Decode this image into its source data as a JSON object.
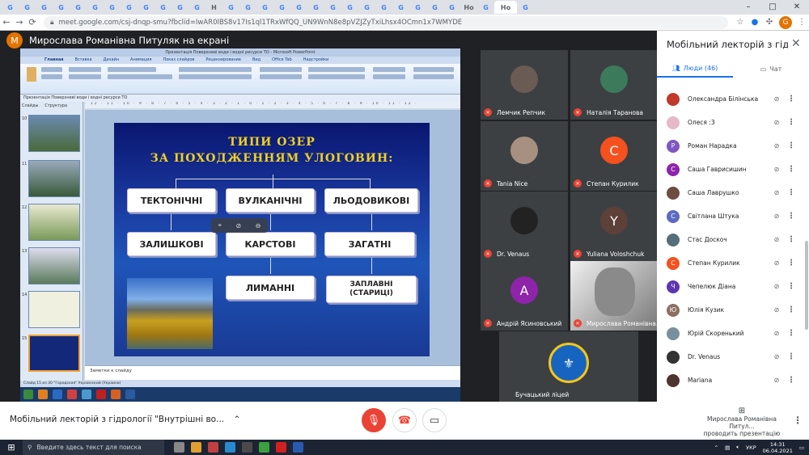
{
  "browser": {
    "tab_icons": [
      "G",
      "G",
      "G",
      "G",
      "G",
      "G",
      "G",
      "G",
      "G",
      "G",
      "G",
      "G",
      "H",
      "G",
      "G",
      "G",
      "G",
      "G",
      "G",
      "G",
      "G",
      "G",
      "G",
      "G",
      "G",
      "G",
      "G",
      "Ho",
      "G",
      "Ho",
      "G"
    ],
    "url": "meet.google.com/csj-dnqp-smu?fbclid=IwAR0IBS8v17Is1ql1TRxWfQQ_UN9WnN8e8pVZJZyTxiLhsx4OCmn1x7WMYDE",
    "profile_initial": "G",
    "window_controls": [
      "–",
      "□",
      "✕"
    ]
  },
  "presenter": {
    "initial": "M",
    "title": "Мирослава Романівна Питуляк на екрані"
  },
  "powerpoint": {
    "title_bar": "Презентація Поверхневі води і водні ресурси ТО - Microsoft PowerPoint",
    "ribbon_tabs": [
      "Главная",
      "Вставка",
      "Дизайн",
      "Анимация",
      "Показ слайдов",
      "Рецензирование",
      "Вид",
      "Office Tab",
      "Надстройки"
    ],
    "pane_tabs": [
      "Слайды",
      "Структура"
    ],
    "document_tab": "Презентація Поверхневі води і водні ресурси ТО",
    "slide_numbers": [
      "10",
      "11",
      "12",
      "13",
      "14",
      "15"
    ],
    "ruler": "· 12 · 11 · 10 · 9 · 8 · 7 · 6 · 5 · 4 · 3 · 2 · 1 · 0 · 1 · 2 · 3 · 4 · 5 · 6 · 7 · 8 · 9 · 10 · 11 · 12 ·",
    "notes_placeholder": "Заметки к слайду",
    "status": "Слайд 15 из 30    \"Городская\"    Украинский (Украина)"
  },
  "slide": {
    "title_line1": "ТИПИ   ОЗЕР",
    "title_line2": "ЗА  ПОХОДЖЕННЯМ  УЛОГОВИН:",
    "types": {
      "tectonic": "ТЕКТОНІЧНІ",
      "volcanic": "ВУЛКАНІЧНІ",
      "glacial": "ЛЬОДОВИКОВІ",
      "residual": "ЗАЛИШКОВІ",
      "karst": "КАРСТОВІ",
      "dammed": "ЗАГАТНІ",
      "estuary": "ЛИМАННІ",
      "floodplain": "ЗАПЛАВНІ\n(СТАРИЦІ)"
    }
  },
  "participants_grid": [
    {
      "name": "Лемчик Репчик",
      "avatar": "photo",
      "color": "#6b5b55"
    },
    {
      "name": "Наталія Таранова",
      "avatar": "photo",
      "color": "#3c7a5c"
    },
    {
      "name": "Tania Nice",
      "avatar": "photo",
      "color": "#a89080"
    },
    {
      "name": "Степан Курилик",
      "avatar": "С",
      "color": "#f4511e"
    },
    {
      "name": "Dr. Venaus",
      "avatar": "photo",
      "color": "#222222"
    },
    {
      "name": "Yuliana Voloshchuk",
      "avatar": "Y",
      "color": "#5d4037"
    },
    {
      "name": "Андрій Ясиновський",
      "avatar": "А",
      "color": "#8e24aa"
    },
    {
      "name": "Мирослава Романівна...",
      "avatar": "video",
      "color": "#cfcfcf"
    },
    {
      "name": "Бучацький ліцей",
      "avatar": "emblem",
      "color": "#1565c0"
    }
  ],
  "side_panel": {
    "title": "Мобільний лекторій з гідрології...",
    "tab_people": "Люди (46)",
    "tab_chat": "Чат",
    "people": [
      {
        "name": "Олександра Білінська",
        "initial": "",
        "color": "#c0392b"
      },
      {
        "name": "Олеся :3",
        "initial": "",
        "color": "#e6b8c8"
      },
      {
        "name": "Роман Нарадка",
        "initial": "Р",
        "color": "#7e57c2"
      },
      {
        "name": "Саша Гаврисишин",
        "initial": "С",
        "color": "#8e24aa"
      },
      {
        "name": "Саша Лаврушко",
        "initial": "",
        "color": "#6d4c41"
      },
      {
        "name": "Світлана Штука",
        "initial": "С",
        "color": "#5c6bc0"
      },
      {
        "name": "Стас Доскоч",
        "initial": "",
        "color": "#546e7a"
      },
      {
        "name": "Степан Курилик",
        "initial": "С",
        "color": "#f4511e"
      },
      {
        "name": "Чепелюк Діана",
        "initial": "Ч",
        "color": "#5e35b1"
      },
      {
        "name": "Юлія Кузик",
        "initial": "Ю",
        "color": "#8d6e63"
      },
      {
        "name": "Юрій Скоренький",
        "initial": "",
        "color": "#78909c"
      },
      {
        "name": "Dr. Venaus",
        "initial": "",
        "color": "#333333"
      },
      {
        "name": "Mariana",
        "initial": "",
        "color": "#4e342e"
      }
    ]
  },
  "meeting_bar": {
    "title": "Мобільний лекторій з гідрології \"Внутрішні во...",
    "presenting_name": "Мирослава Романівна Питул...",
    "presenting_sub": "проводить презентацію"
  },
  "taskbar": {
    "search_placeholder": "Введите здесь текст для поиска",
    "lang": "УКР",
    "time": "14:31",
    "date": "06.04.2021"
  },
  "colors": {
    "meet_bg": "#202124",
    "mic_off": "#ea4335",
    "accent": "#1a73e8"
  }
}
